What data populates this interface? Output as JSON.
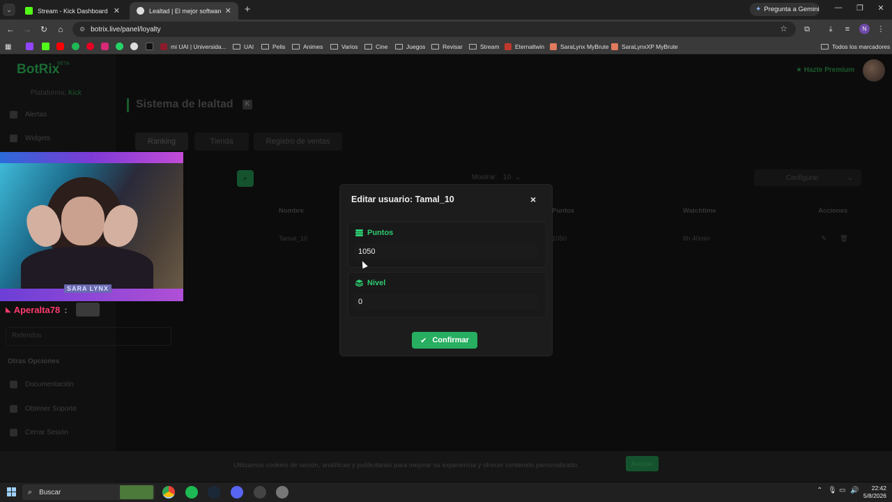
{
  "browser": {
    "tabs": [
      {
        "title": "Stream - Kick Dashboard"
      },
      {
        "title": "Lealtad | El mejor software para"
      }
    ],
    "gemini_label": "Pregunta a Gemini",
    "url": "botrix.live/panel/loyalty",
    "bookmarks": {
      "uai_unicode": "mi UAI | Universida...",
      "folders": [
        "UAI",
        "Pelis",
        "Animes",
        "Varios",
        "Cine",
        "Juegos",
        "Revisar",
        "Stream"
      ],
      "eternaltwin": "Eternaltwin",
      "mybrute1": "SaraLynx MyBrute",
      "mybrute2": "SaraLynxXP MyBrute",
      "all": "Todos los marcadores"
    },
    "profile_initial": "N"
  },
  "app": {
    "logo": "BotRix",
    "logo_badge": "BETA",
    "platform_label": "Plataforma:",
    "platform_value": "Kick",
    "premium": "Hazte Premium",
    "sidebar": {
      "items": [
        "Alertas",
        "Widgets"
      ],
      "section": "Otras Opciones",
      "bottom_items": [
        "Documentación",
        "Obtener Soporte",
        "Cerrar Sesión"
      ],
      "hidden_item": "Referidos"
    },
    "page_title": "Sistema de lealtad",
    "tabs": [
      "Ranking",
      "Tienda",
      "Registro de ventas"
    ],
    "show_label": "Mostrar:",
    "show_value": "10",
    "configure": "Configurar",
    "table_headers": [
      "Nombre",
      "Puntos",
      "Watchtime",
      "Acciones"
    ],
    "row": {
      "name": "Tamal_10",
      "points": "1050",
      "watchtime": "8h 40min"
    },
    "cookie_text": "Utilizamos cookies de sesión, analíticas y publicitarias para mejorar su experiencia y ofrecer contenido personalizado.",
    "cookie_accept": "Aceptar"
  },
  "overlay": {
    "streamer_name": "SARA LYNX",
    "chat_user": "Aperalta78",
    "chat_sep": ":"
  },
  "modal": {
    "title": "Editar usuario: Tamal_10",
    "close": "×",
    "fields": [
      {
        "label": "Puntos",
        "value": "1050"
      },
      {
        "label": "Nivel",
        "value": "0"
      }
    ],
    "confirm": "Confirmar",
    "accent": "#27ae60"
  },
  "taskbar": {
    "search": "Buscar",
    "time": "22:42",
    "date": "5/8/2026"
  }
}
